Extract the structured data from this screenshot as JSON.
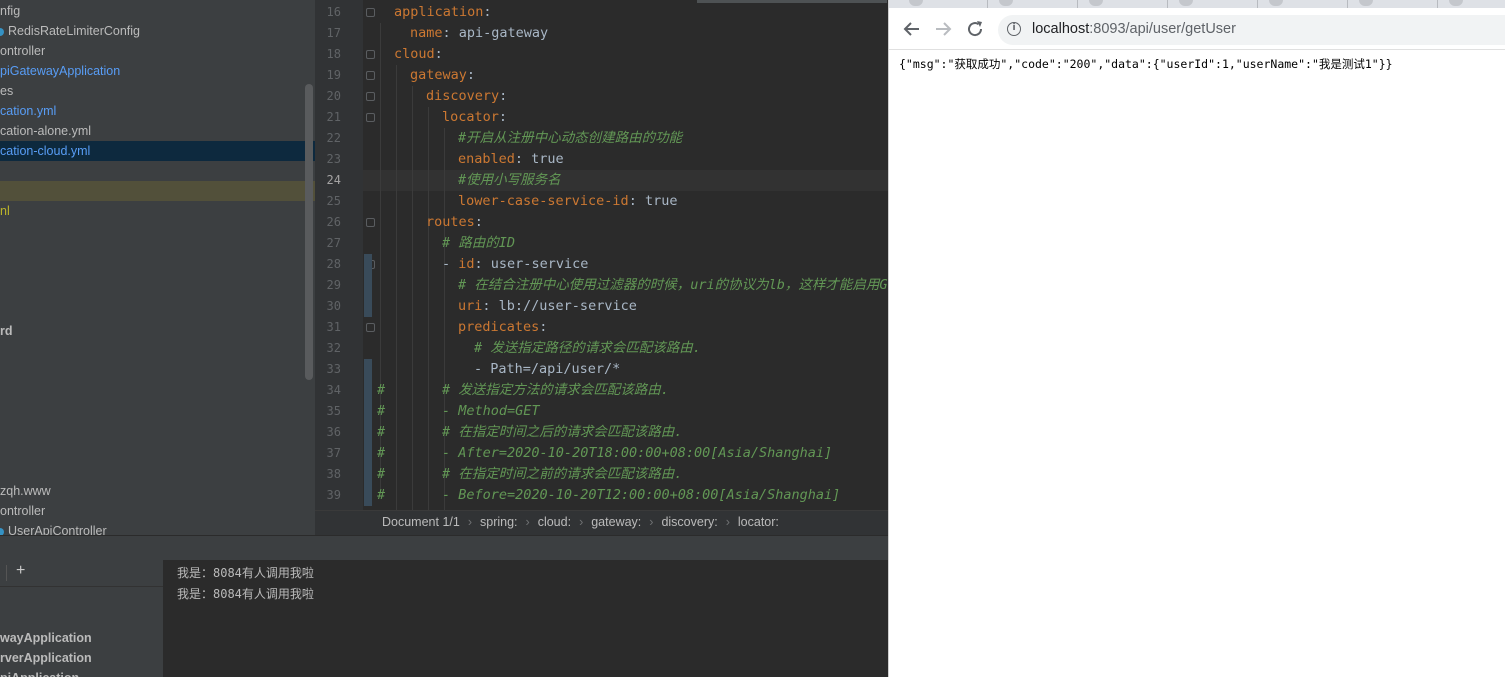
{
  "project_tree": {
    "items": [
      {
        "label": "nfig",
        "style": "plain"
      },
      {
        "label": "RedisRateLimiterConfig",
        "style": "class"
      },
      {
        "label": "ontroller",
        "style": "plain"
      },
      {
        "label": "piGatewayApplication",
        "style": "blue"
      },
      {
        "label": "es",
        "style": "plain"
      },
      {
        "label": "cation.yml",
        "style": "blue"
      },
      {
        "label": "cation-alone.yml",
        "style": "plain"
      },
      {
        "label": "cation-cloud.yml",
        "style": "selected"
      },
      {
        "label": "",
        "style": "plain"
      },
      {
        "label": "",
        "style": "highlight"
      },
      {
        "label": "nl",
        "style": "olive"
      },
      {
        "label": "rd",
        "style": "bold"
      },
      {
        "label": "zqh.www",
        "style": "plain"
      },
      {
        "label": "ontroller",
        "style": "plain"
      },
      {
        "label": "UserApiController",
        "style": "class"
      }
    ]
  },
  "editor": {
    "line_numbers": [
      "16",
      "17",
      "18",
      "19",
      "20",
      "21",
      "22",
      "23",
      "24",
      "25",
      "26",
      "27",
      "28",
      "29",
      "30",
      "31",
      "32",
      "33",
      "34",
      "35",
      "36",
      "37",
      "38",
      "39"
    ],
    "current_line": "24",
    "lines": [
      {
        "indent": 0,
        "key": "application",
        "sep": ":",
        "value": "",
        "comment": ""
      },
      {
        "indent": 1,
        "key": "name",
        "sep": ":",
        "value": " api-gateway",
        "comment": ""
      },
      {
        "indent": 0,
        "key": "cloud",
        "sep": ":",
        "value": "",
        "comment": ""
      },
      {
        "indent": 1,
        "key": "gateway",
        "sep": ":",
        "value": "",
        "comment": ""
      },
      {
        "indent": 2,
        "key": "discovery",
        "sep": ":",
        "value": "",
        "comment": ""
      },
      {
        "indent": 3,
        "key": "locator",
        "sep": ":",
        "value": "",
        "comment": ""
      },
      {
        "indent": 4,
        "key": "",
        "sep": "",
        "value": "",
        "comment": "#开启从注册中心动态创建路由的功能"
      },
      {
        "indent": 4,
        "key": "enabled",
        "sep": ":",
        "value": " true",
        "comment": ""
      },
      {
        "indent": 4,
        "key": "",
        "sep": "",
        "value": "",
        "comment": "#使用小写服务名"
      },
      {
        "indent": 4,
        "key": "lower-case-service-id",
        "sep": ":",
        "value": " true",
        "comment": ""
      },
      {
        "indent": 2,
        "key": "routes",
        "sep": ":",
        "value": "",
        "comment": ""
      },
      {
        "indent": 3,
        "key": "",
        "sep": "",
        "value": "",
        "comment": "# 路由的ID"
      },
      {
        "indent": 3,
        "key": "id",
        "sep": ":",
        "value": " user-service",
        "comment": "",
        "dash": "- "
      },
      {
        "indent": 4,
        "key": "",
        "sep": "",
        "value": "",
        "comment": "# 在结合注册中心使用过滤器的时候，uri的协议为lb，这样才能启用Gat"
      },
      {
        "indent": 4,
        "key": "uri",
        "sep": ":",
        "value": " lb://user-service",
        "comment": ""
      },
      {
        "indent": 4,
        "key": "predicates",
        "sep": ":",
        "value": "",
        "comment": ""
      },
      {
        "indent": 5,
        "key": "",
        "sep": "",
        "value": "",
        "comment": "# 发送指定路径的请求会匹配该路由."
      },
      {
        "indent": 5,
        "key": "",
        "sep": "",
        "value": "- Path=/api/user/*",
        "comment": ""
      },
      {
        "indent": -1,
        "key": "",
        "sep": "",
        "value": "",
        "comment": "#       # 发送指定方法的请求会匹配该路由."
      },
      {
        "indent": -1,
        "key": "",
        "sep": "",
        "value": "",
        "comment": "#       - Method=GET"
      },
      {
        "indent": -1,
        "key": "",
        "sep": "",
        "value": "",
        "comment": "#       # 在指定时间之后的请求会匹配该路由."
      },
      {
        "indent": -1,
        "key": "",
        "sep": "",
        "value": "",
        "comment": "#       - After=2020-10-20T18:00:00+08:00[Asia/Shanghai]"
      },
      {
        "indent": -1,
        "key": "",
        "sep": "",
        "value": "",
        "comment": "#       # 在指定时间之前的请求会匹配该路由."
      },
      {
        "indent": -1,
        "key": "",
        "sep": "",
        "value": "",
        "comment": "#       - Before=2020-10-20T12:00:00+08:00[Asia/Shanghai]"
      }
    ]
  },
  "breadcrumb": [
    "Document 1/1",
    "spring:",
    "cloud:",
    "gateway:",
    "discovery:",
    "locator:"
  ],
  "run_panel": {
    "add_icon": "+",
    "apps": [
      "wayApplication",
      "rverApplication",
      "piApplication"
    ],
    "console_lines": [
      "我是：8084有人调用我啦",
      "我是：8084有人调用我啦"
    ]
  },
  "browser": {
    "url_host": "localhost",
    "url_rest": ":8093/api/user/getUser",
    "body": "{\"msg\":\"获取成功\",\"code\":\"200\",\"data\":{\"userId\":1,\"userName\":\"我是测试1\"}}",
    "icons": [
      "back-arrow-icon",
      "forward-arrow-icon",
      "reload-icon",
      "info-icon"
    ]
  },
  "colors": {
    "ide_bg": "#2b2b2b",
    "panel_bg": "#3c3f41",
    "yaml_key": "#cc7832",
    "yaml_comment": "#629755",
    "selection": "#0d293e"
  }
}
